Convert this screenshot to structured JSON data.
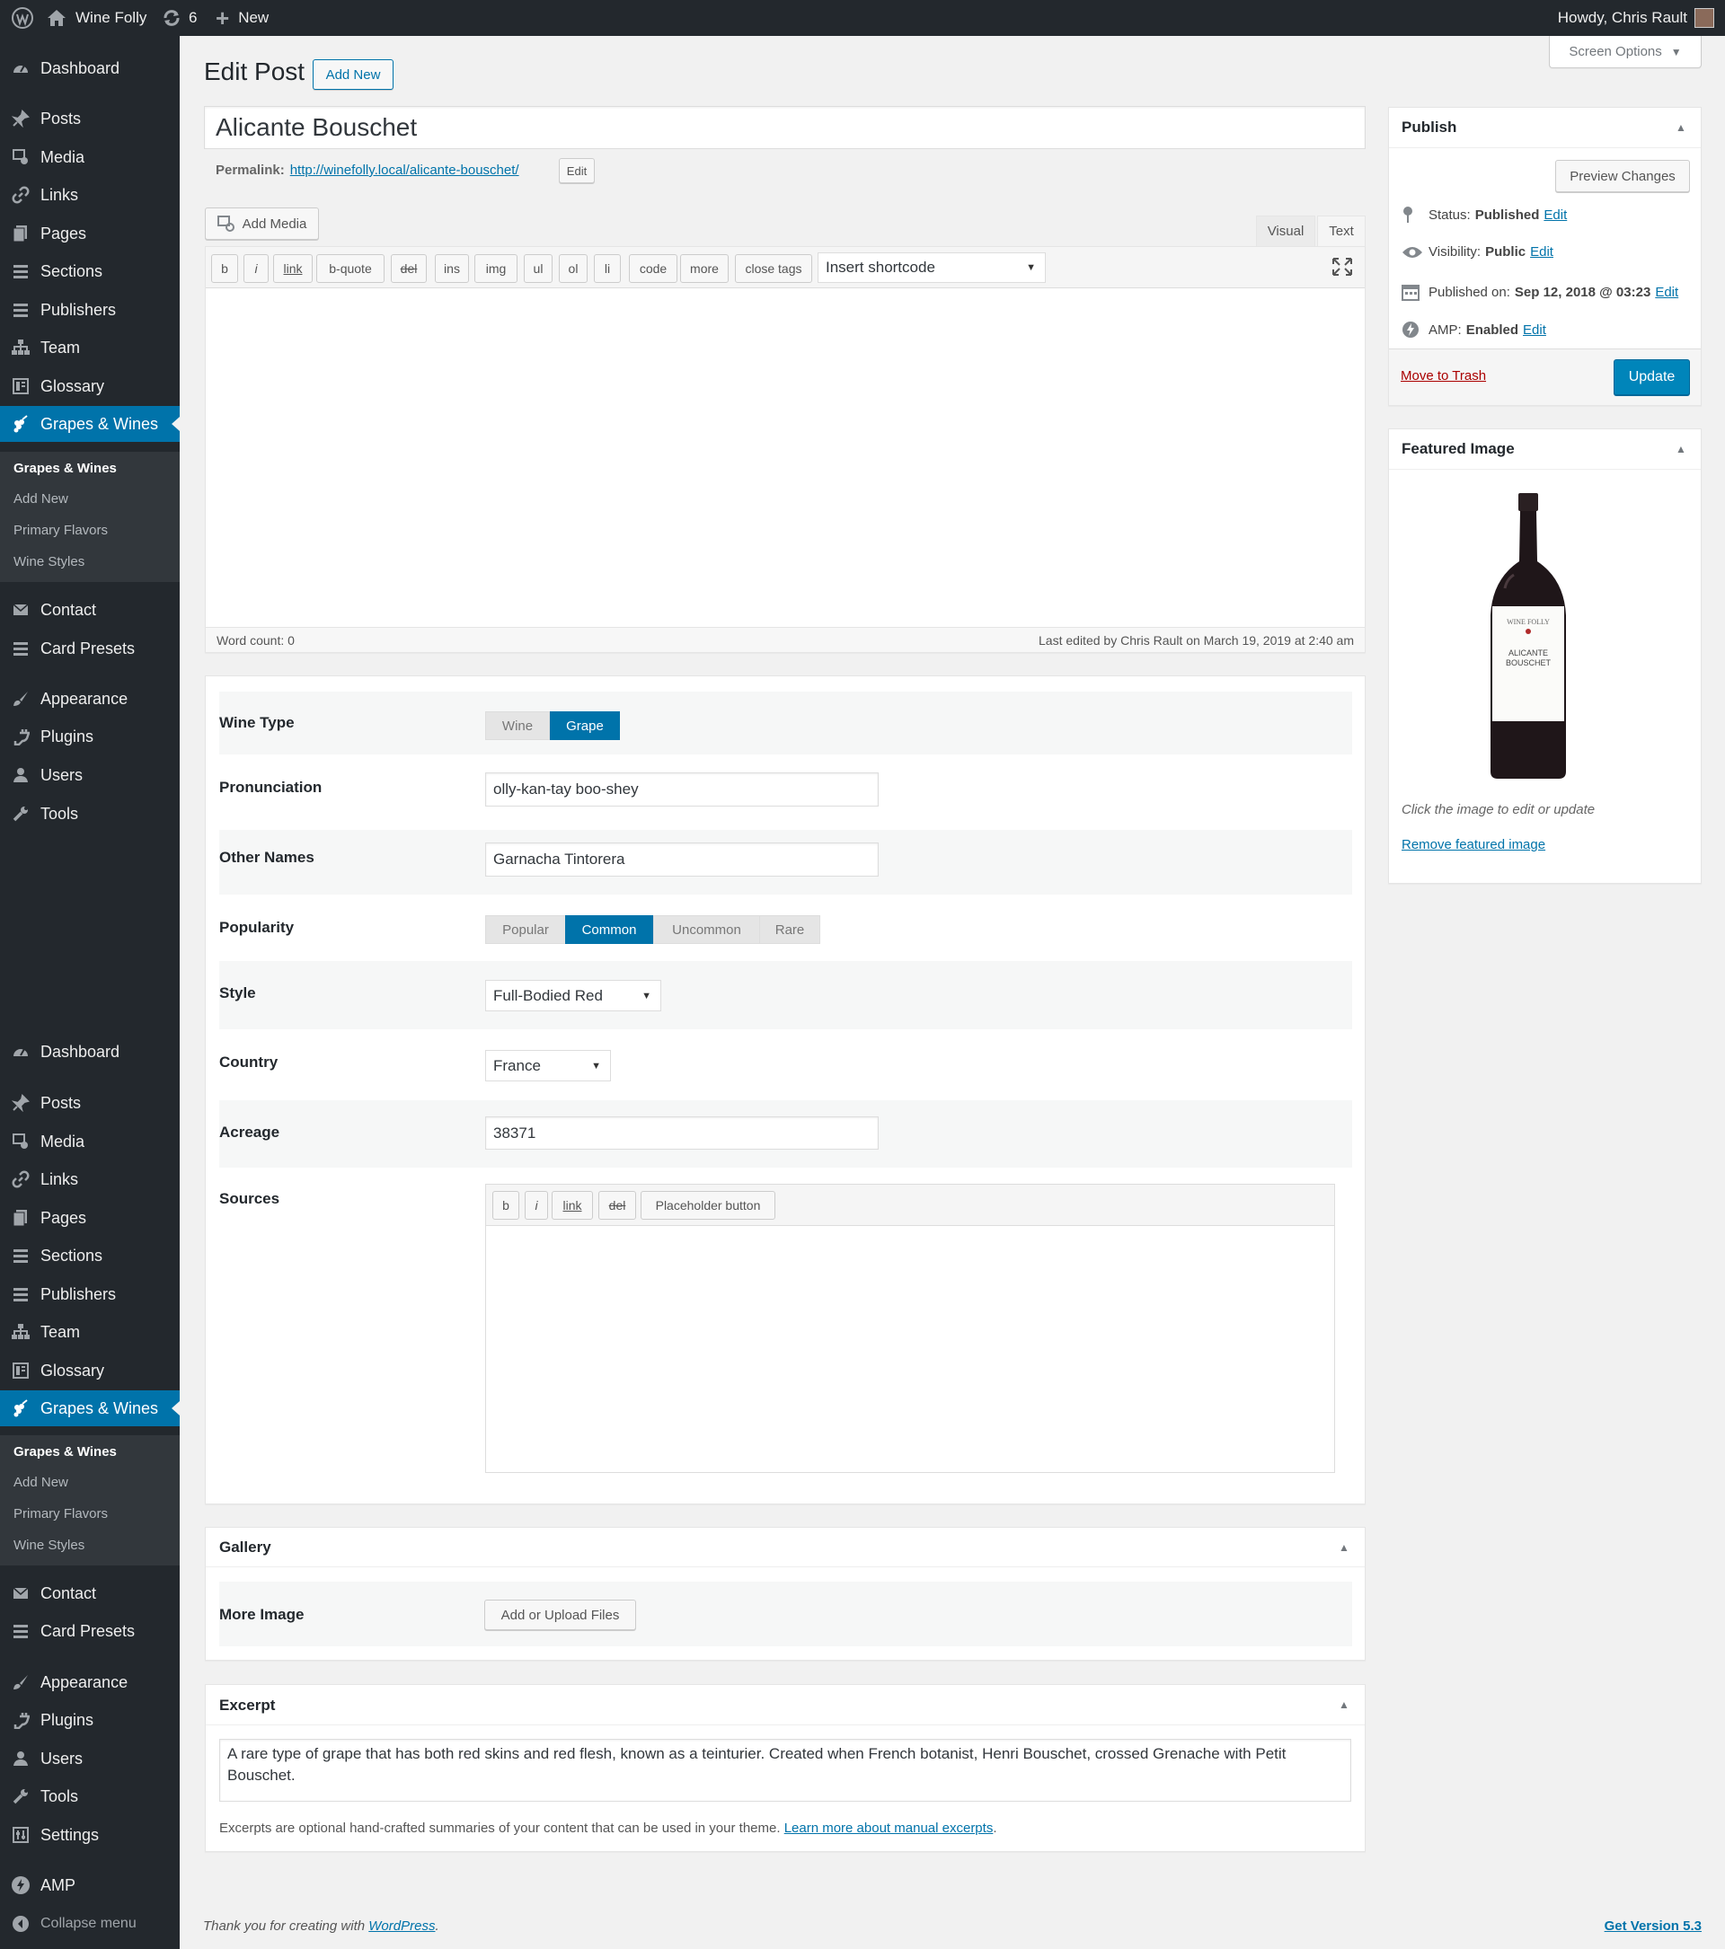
{
  "admin_bar": {
    "site_name": "Wine Folly",
    "updates_count": "6",
    "new_label": "New",
    "greeting": "Howdy, Chris Rault"
  },
  "sidebar": {
    "menu1": [
      {
        "label": "Dashboard",
        "icon": "dashboard-icon"
      },
      {
        "label": "Posts",
        "icon": "pin-icon"
      },
      {
        "label": "Media",
        "icon": "media-icon"
      },
      {
        "label": "Links",
        "icon": "link-icon"
      },
      {
        "label": "Pages",
        "icon": "pages-icon"
      },
      {
        "label": "Sections",
        "icon": "list-icon"
      },
      {
        "label": "Publishers",
        "icon": "list-icon"
      },
      {
        "label": "Team",
        "icon": "team-icon"
      },
      {
        "label": "Glossary",
        "icon": "book-icon"
      },
      {
        "label": "Grapes & Wines",
        "icon": "grapes-icon"
      }
    ],
    "submenu1": [
      "Grapes & Wines",
      "Add New",
      "Primary Flavors",
      "Wine Styles"
    ],
    "menu1b": [
      {
        "label": "Contact",
        "icon": "mail-icon"
      },
      {
        "label": "Card Presets",
        "icon": "list-icon"
      },
      {
        "label": "Appearance",
        "icon": "brush-icon"
      },
      {
        "label": "Plugins",
        "icon": "plugin-icon"
      },
      {
        "label": "Users",
        "icon": "user-icon"
      },
      {
        "label": "Tools",
        "icon": "wrench-icon"
      }
    ],
    "menu2": [
      {
        "label": "Dashboard",
        "icon": "dashboard-icon"
      },
      {
        "label": "Posts",
        "icon": "pin-icon"
      },
      {
        "label": "Media",
        "icon": "media-icon"
      },
      {
        "label": "Links",
        "icon": "link-icon"
      },
      {
        "label": "Pages",
        "icon": "pages-icon"
      },
      {
        "label": "Sections",
        "icon": "list-icon"
      },
      {
        "label": "Publishers",
        "icon": "list-icon"
      },
      {
        "label": "Team",
        "icon": "team-icon"
      },
      {
        "label": "Glossary",
        "icon": "book-icon"
      },
      {
        "label": "Grapes & Wines",
        "icon": "grapes-icon"
      }
    ],
    "submenu2": [
      "Grapes & Wines",
      "Add New",
      "Primary Flavors",
      "Wine Styles"
    ],
    "menu2b": [
      {
        "label": "Contact",
        "icon": "mail-icon"
      },
      {
        "label": "Card Presets",
        "icon": "list-icon"
      },
      {
        "label": "Appearance",
        "icon": "brush-icon"
      },
      {
        "label": "Plugins",
        "icon": "plugin-icon"
      },
      {
        "label": "Users",
        "icon": "user-icon"
      },
      {
        "label": "Tools",
        "icon": "wrench-icon"
      },
      {
        "label": "Settings",
        "icon": "settings-icon"
      },
      {
        "label": "AMP",
        "icon": "amp-icon"
      },
      {
        "label": "Collapse menu",
        "icon": "collapse-icon"
      }
    ]
  },
  "header": {
    "title": "Edit Post",
    "add_new": "Add New",
    "screen_options": "Screen Options"
  },
  "post": {
    "title": "Alicante Bouschet",
    "permalink_label": "Permalink:",
    "permalink_base": "http://winefolly.local/",
    "permalink_slug": "alicante-bouschet",
    "permalink_trail": "/",
    "permalink_edit": "Edit"
  },
  "editor": {
    "add_media": "Add Media",
    "tab_visual": "Visual",
    "tab_text": "Text",
    "quicktags": [
      "b",
      "i",
      "link",
      "b-quote",
      "del",
      "ins",
      "img",
      "ul",
      "ol",
      "li",
      "code",
      "more",
      "close tags"
    ],
    "shortcode_select": "Insert shortcode",
    "word_count": "Word count: 0",
    "last_edited": "Last edited by Chris Rault on March 19, 2019 at 2:40 am"
  },
  "fields": {
    "wine_type": {
      "label": "Wine Type",
      "options": [
        "Wine",
        "Grape"
      ],
      "selected": "Grape"
    },
    "pronunciation": {
      "label": "Pronunciation",
      "value": "olly-kan-tay boo-shey"
    },
    "other_names": {
      "label": "Other Names",
      "value": "Garnacha Tintorera"
    },
    "popularity": {
      "label": "Popularity",
      "options": [
        "Popular",
        "Common",
        "Uncommon",
        "Rare"
      ],
      "selected": "Common"
    },
    "style": {
      "label": "Style",
      "value": "Full-Bodied Red"
    },
    "country": {
      "label": "Country",
      "value": "France"
    },
    "acreage": {
      "label": "Acreage",
      "value": "38371"
    },
    "sources": {
      "label": "Sources",
      "toolbar": [
        "b",
        "i",
        "link",
        "del",
        "Placeholder button"
      ]
    }
  },
  "gallery": {
    "title": "Gallery",
    "field_label": "More Image",
    "button": "Add or Upload Files"
  },
  "excerpt": {
    "title": "Excerpt",
    "text": "A rare type of grape that has both red skins and red flesh, known as a teinturier. Created when French botanist, Henri Bouschet, crossed Grenache with Petit Bouschet.",
    "help_text": "Excerpts are optional hand-crafted summaries of your content that can be used in your theme.",
    "help_link": "Learn more about manual excerpts",
    "help_end": "."
  },
  "publish": {
    "title": "Publish",
    "preview": "Preview Changes",
    "status_label": "Status:",
    "status_value": "Published",
    "visibility_label": "Visibility:",
    "visibility_value": "Public",
    "published_label": "Published on:",
    "published_value": "Sep 12, 2018 @ 03:23",
    "amp_label": "AMP:",
    "amp_value": "Enabled",
    "edit": "Edit",
    "trash": "Move to Trash",
    "update": "Update"
  },
  "featured": {
    "title": "Featured Image",
    "label_brand": "WINE FOLLY",
    "label_line1": "ALICANTE",
    "label_line2": "BOUSCHET",
    "hint": "Click the image to edit or update",
    "remove": "Remove featured image"
  },
  "footer": {
    "thanks": "Thank you for creating with",
    "wp_link": "WordPress",
    "thanks_end": ".",
    "version": "Get Version 5.3"
  },
  "colors": {
    "accent": "#0073aa",
    "primary_button": "#0085ba",
    "sidebar_bg": "#23282d",
    "trash": "#a00"
  }
}
